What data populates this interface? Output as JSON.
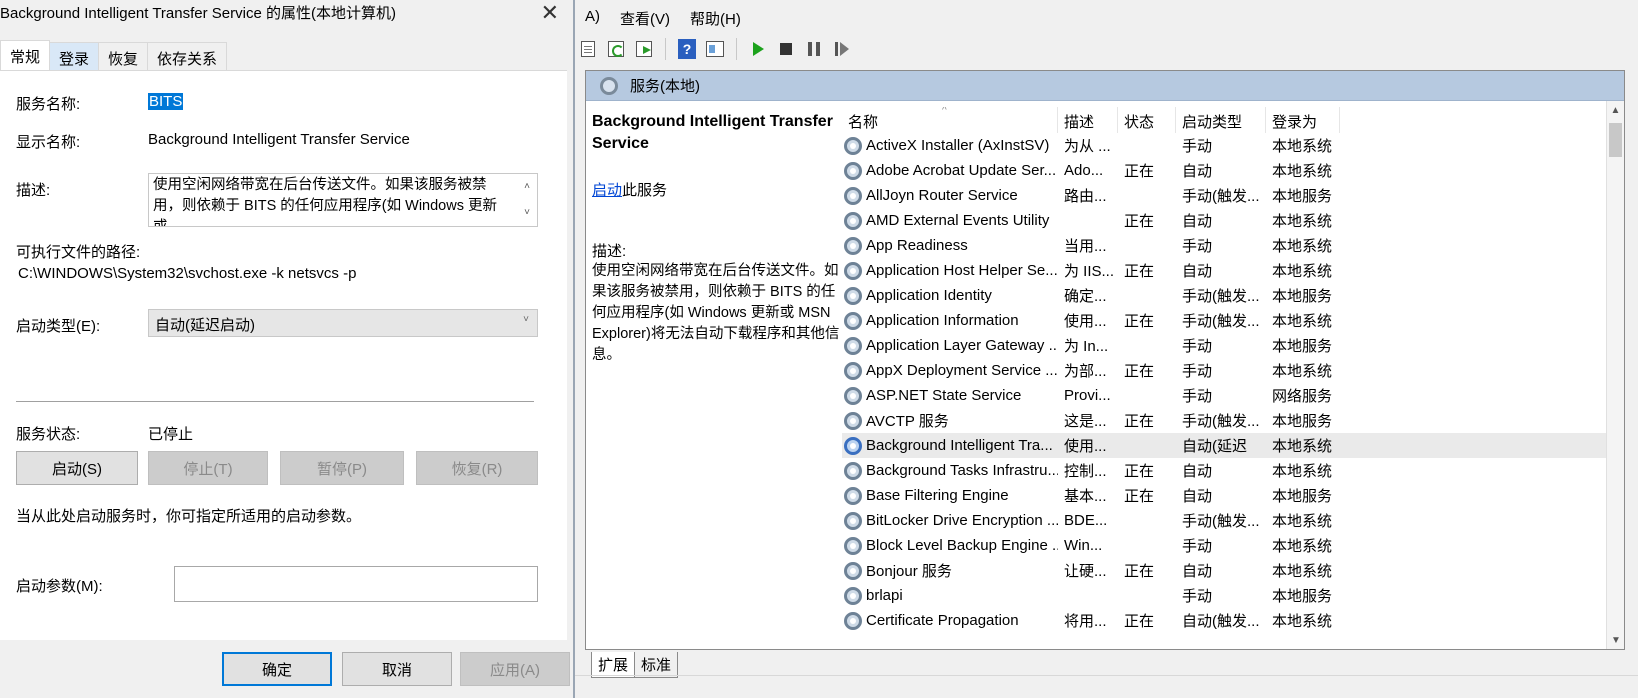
{
  "dialog": {
    "title": "Background Intelligent Transfer Service 的属性(本地计算机)",
    "close_glyph": "✕",
    "tabs": [
      "常规",
      "登录",
      "恢复",
      "依存关系"
    ],
    "service_name_label": "服务名称:",
    "service_name_value": "BITS",
    "display_name_label": "显示名称:",
    "display_name_value": "Background Intelligent Transfer Service",
    "description_label": "描述:",
    "description_value": "使用空闲网络带宽在后台传送文件。如果该服务被禁用，则依赖于 BITS 的任何应用程序(如 Windows 更新或",
    "exe_path_label": "可执行文件的路径:",
    "exe_path_value": "C:\\WINDOWS\\System32\\svchost.exe -k netsvcs -p",
    "startup_type_label": "启动类型(E):",
    "startup_type_value": "自动(延迟启动)",
    "status_label": "服务状态:",
    "status_value": "已停止",
    "buttons": {
      "start": "启动(S)",
      "stop": "停止(T)",
      "pause": "暂停(P)",
      "resume": "恢复(R)"
    },
    "hint": "当从此处启动服务时，你可指定所适用的启动参数。",
    "params_label": "启动参数(M):",
    "params_value": "",
    "footer": {
      "ok": "确定",
      "cancel": "取消",
      "apply": "应用(A)"
    }
  },
  "services_window": {
    "menu": [
      "A)",
      "查看(V)",
      "帮助(H)"
    ],
    "panel_title": "服务(本地)",
    "desc_pane": {
      "title": "Background Intelligent Transfer Service",
      "action_link": "启动",
      "action_suffix": "此服务",
      "desc_label": "描述:",
      "desc_text": "使用空闲网络带宽在后台传送文件。如果该服务被禁用，则依赖于 BITS 的任何应用程序(如 Windows 更新或 MSN Explorer)将无法自动下载程序和其他信息。"
    },
    "columns": [
      "名称",
      "描述",
      "状态",
      "启动类型",
      "登录为"
    ],
    "rows": [
      {
        "name": "ActiveX Installer (AxInstSV)",
        "desc": "为从 ...",
        "status": "",
        "startup": "手动",
        "logon": "本地系统"
      },
      {
        "name": "Adobe Acrobat Update Ser...",
        "desc": "Ado...",
        "status": "正在",
        "startup": "自动",
        "logon": "本地系统"
      },
      {
        "name": "AllJoyn Router Service",
        "desc": "路由...",
        "status": "",
        "startup": "手动(触发...",
        "logon": "本地服务"
      },
      {
        "name": "AMD External Events Utility",
        "desc": "",
        "status": "正在",
        "startup": "自动",
        "logon": "本地系统"
      },
      {
        "name": "App Readiness",
        "desc": "当用...",
        "status": "",
        "startup": "手动",
        "logon": "本地系统"
      },
      {
        "name": "Application Host Helper Se...",
        "desc": "为 IIS...",
        "status": "正在",
        "startup": "自动",
        "logon": "本地系统"
      },
      {
        "name": "Application Identity",
        "desc": "确定...",
        "status": "",
        "startup": "手动(触发...",
        "logon": "本地服务"
      },
      {
        "name": "Application Information",
        "desc": "使用...",
        "status": "正在",
        "startup": "手动(触发...",
        "logon": "本地系统"
      },
      {
        "name": "Application Layer Gateway ...",
        "desc": "为 In...",
        "status": "",
        "startup": "手动",
        "logon": "本地服务"
      },
      {
        "name": "AppX Deployment Service ...",
        "desc": "为部...",
        "status": "正在",
        "startup": "手动",
        "logon": "本地系统"
      },
      {
        "name": "ASP.NET State Service",
        "desc": "Provi...",
        "status": "",
        "startup": "手动",
        "logon": "网络服务"
      },
      {
        "name": "AVCTP 服务",
        "desc": "这是...",
        "status": "正在",
        "startup": "手动(触发...",
        "logon": "本地服务"
      },
      {
        "name": "Background Intelligent Tra...",
        "desc": "使用...",
        "status": "",
        "startup": "自动(延迟",
        "logon": "本地系统",
        "selected": true
      },
      {
        "name": "Background Tasks Infrastru...",
        "desc": "控制...",
        "status": "正在",
        "startup": "自动",
        "logon": "本地系统"
      },
      {
        "name": "Base Filtering Engine",
        "desc": "基本...",
        "status": "正在",
        "startup": "自动",
        "logon": "本地服务"
      },
      {
        "name": "BitLocker Drive Encryption ...",
        "desc": "BDE...",
        "status": "",
        "startup": "手动(触发...",
        "logon": "本地系统"
      },
      {
        "name": "Block Level Backup Engine ...",
        "desc": "Win...",
        "status": "",
        "startup": "手动",
        "logon": "本地系统"
      },
      {
        "name": "Bonjour 服务",
        "desc": "让硬...",
        "status": "正在",
        "startup": "自动",
        "logon": "本地系统"
      },
      {
        "name": "brlapi",
        "desc": "",
        "status": "",
        "startup": "手动",
        "logon": "本地服务"
      },
      {
        "name": "Certificate Propagation",
        "desc": "将用...",
        "status": "正在",
        "startup": "自动(触发...",
        "logon": "本地系统"
      }
    ],
    "bottom_tabs": [
      "扩展",
      "标准"
    ]
  }
}
